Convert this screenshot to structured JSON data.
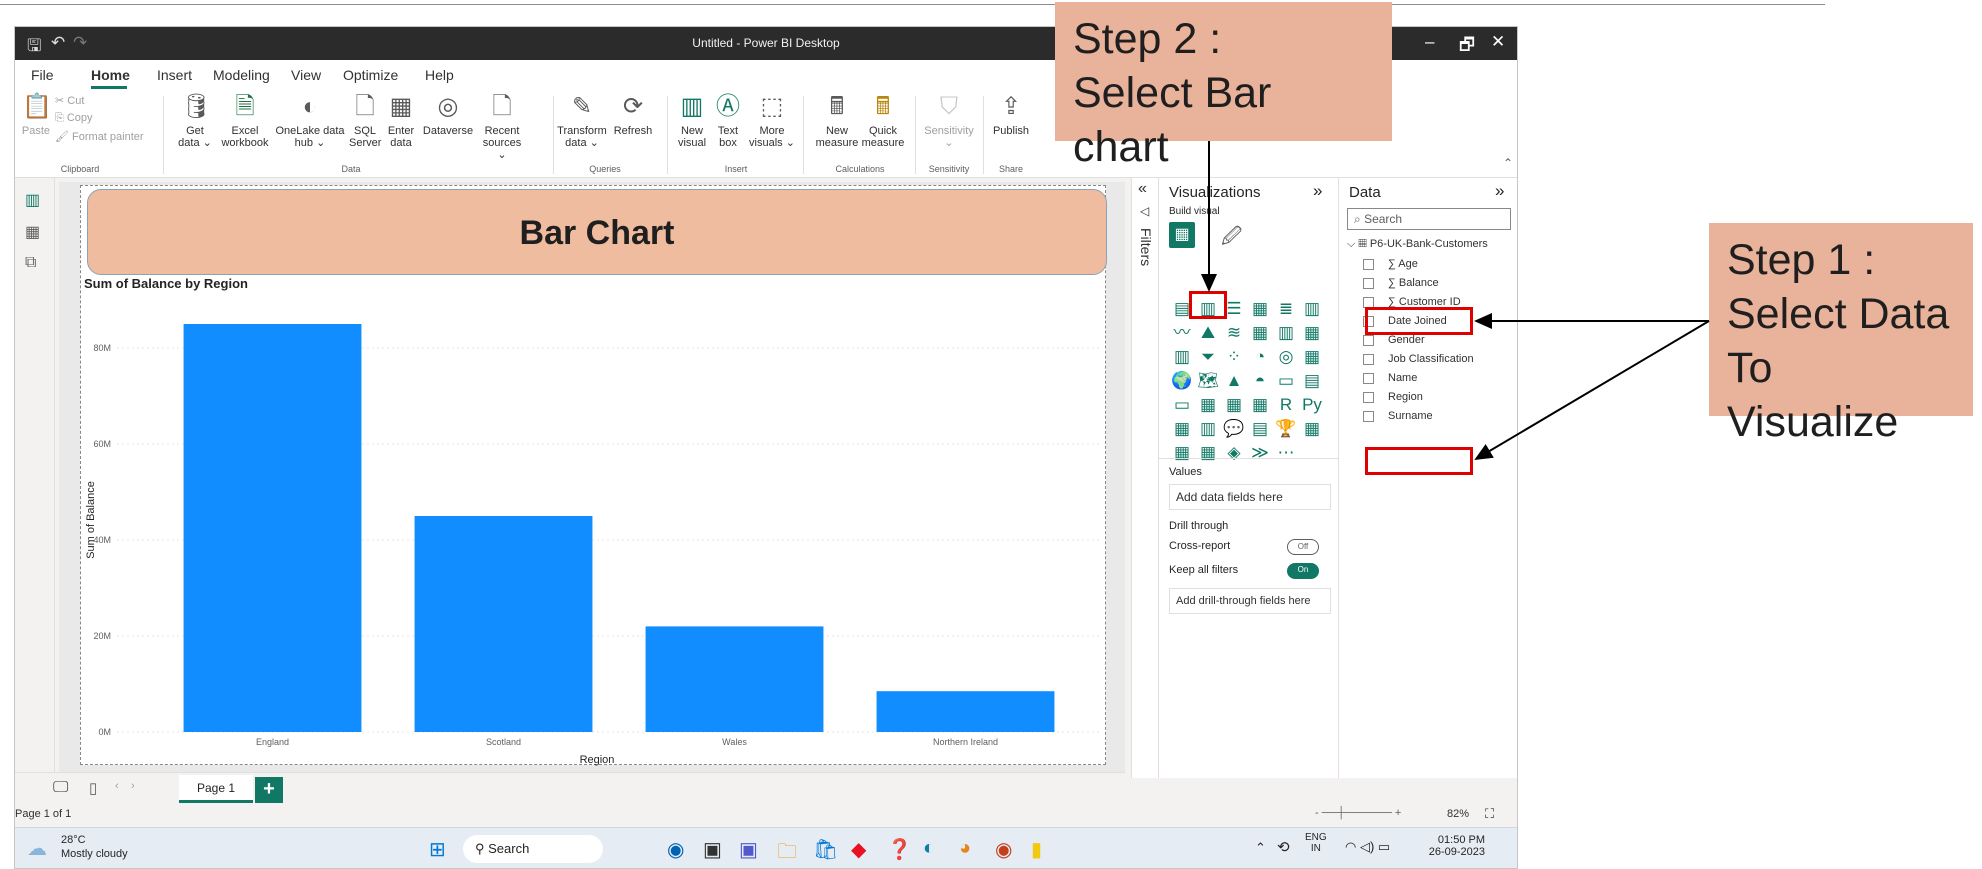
{
  "window": {
    "title": "Untitled - Power BI Desktop",
    "controls": [
      "–",
      "🗗",
      "✕"
    ]
  },
  "menu": {
    "items": [
      "File",
      "Home",
      "Insert",
      "Modeling",
      "View",
      "Optimize",
      "Help"
    ],
    "active": "Home"
  },
  "ribbon": {
    "clipboard": {
      "paste": "Paste",
      "cut": "Cut",
      "copy": "Copy",
      "format_painter": "Format painter",
      "group": "Clipboard"
    },
    "data": [
      {
        "l1": "Get",
        "l2": "data ⌄"
      },
      {
        "l1": "Excel",
        "l2": "workbook"
      },
      {
        "l1": "OneLake data",
        "l2": "hub ⌄"
      },
      {
        "l1": "SQL",
        "l2": "Server"
      },
      {
        "l1": "Enter",
        "l2": "data"
      },
      {
        "l1": "Dataverse",
        "l2": ""
      },
      {
        "l1": "Recent",
        "l2": "sources ⌄"
      }
    ],
    "data_group": "Data",
    "queries": [
      {
        "l1": "Transform",
        "l2": "data ⌄"
      },
      {
        "l1": "Refresh",
        "l2": ""
      }
    ],
    "queries_group": "Queries",
    "insert": [
      {
        "l1": "New",
        "l2": "visual"
      },
      {
        "l1": "Text",
        "l2": "box"
      },
      {
        "l1": "More",
        "l2": "visuals ⌄"
      }
    ],
    "insert_group": "Insert",
    "calculations": [
      {
        "l1": "New",
        "l2": "measure"
      },
      {
        "l1": "Quick",
        "l2": "measure"
      }
    ],
    "calculations_group": "Calculations",
    "sensitivity": {
      "l1": "Sensitivity",
      "l2": "⌄"
    },
    "sensitivity_group": "Sensitivity",
    "share": {
      "l1": "Publish",
      "l2": ""
    },
    "share_group": "Share"
  },
  "banner": {
    "text": "Bar Chart"
  },
  "chart_data": {
    "type": "bar",
    "title": "Sum of Balance by Region",
    "xlabel": "Region",
    "ylabel": "Sum of Balance",
    "categories": [
      "England",
      "Scotland",
      "Wales",
      "Northern Ireland"
    ],
    "values": [
      85,
      45,
      22,
      8.5
    ],
    "unit": "M",
    "ylim": [
      0,
      90
    ],
    "yticks": [
      "0M",
      "20M",
      "40M",
      "60M",
      "80M"
    ],
    "ytick_values": [
      0,
      20,
      40,
      60,
      80
    ],
    "bar_color": "#118dff",
    "grid": true
  },
  "pages": {
    "tab": "Page 1",
    "add": "+"
  },
  "filters": {
    "label": "Filters"
  },
  "visualizations": {
    "header": "Visualizations",
    "build": "Build visual",
    "values_label": "Values",
    "values_placeholder": "Add data fields here",
    "drill_label": "Drill through",
    "cross_report": "Cross-report",
    "cross_report_state": "Off",
    "keep_filters": "Keep all filters",
    "keep_filters_state": "On",
    "drill_placeholder": "Add drill-through fields here",
    "icons": [
      "▤",
      "▥",
      "☰",
      "▦",
      "≣",
      "▥",
      "〰",
      "⛰",
      "≋",
      "▦",
      "▥",
      "▦",
      "▥",
      "⏷",
      "⁘",
      "◔",
      "◎",
      "▦",
      "🌍",
      "🗺",
      "▲",
      "◓",
      "▭",
      "▤",
      "▭",
      "▦",
      "▦",
      "▦",
      "R",
      "Py",
      "▦",
      "▥",
      "💬",
      "▤",
      "🏆",
      "▦",
      "▦",
      "▦",
      "◈",
      "≫",
      "⋯"
    ]
  },
  "data_pane": {
    "header": "Data",
    "search_placeholder": "Search",
    "table": "P6-UK-Bank-Customers",
    "fields": [
      {
        "name": "Age",
        "sigma": true
      },
      {
        "name": "Balance",
        "sigma": true
      },
      {
        "name": "Customer ID",
        "sigma": true
      },
      {
        "name": "Date Joined",
        "sigma": false
      },
      {
        "name": "Gender",
        "sigma": false
      },
      {
        "name": "Job Classification",
        "sigma": false
      },
      {
        "name": "Name",
        "sigma": false
      },
      {
        "name": "Region",
        "sigma": false
      },
      {
        "name": "Surname",
        "sigma": false
      }
    ]
  },
  "status": {
    "page": "Page 1 of 1",
    "zoom": "82%"
  },
  "taskbar": {
    "temp": "28°C",
    "weather": "Mostly cloudy",
    "search": "Search",
    "lang1": "ENG",
    "lang2": "IN",
    "time": "01:50 PM",
    "date": "26-09-2023"
  },
  "annotations": {
    "step2_line1": "Step 2 :",
    "step2_line2": "Select Bar chart",
    "step1_line1": "Step 1 :",
    "step1_line2": "Select Data",
    "step1_line3": "To Visualize"
  }
}
